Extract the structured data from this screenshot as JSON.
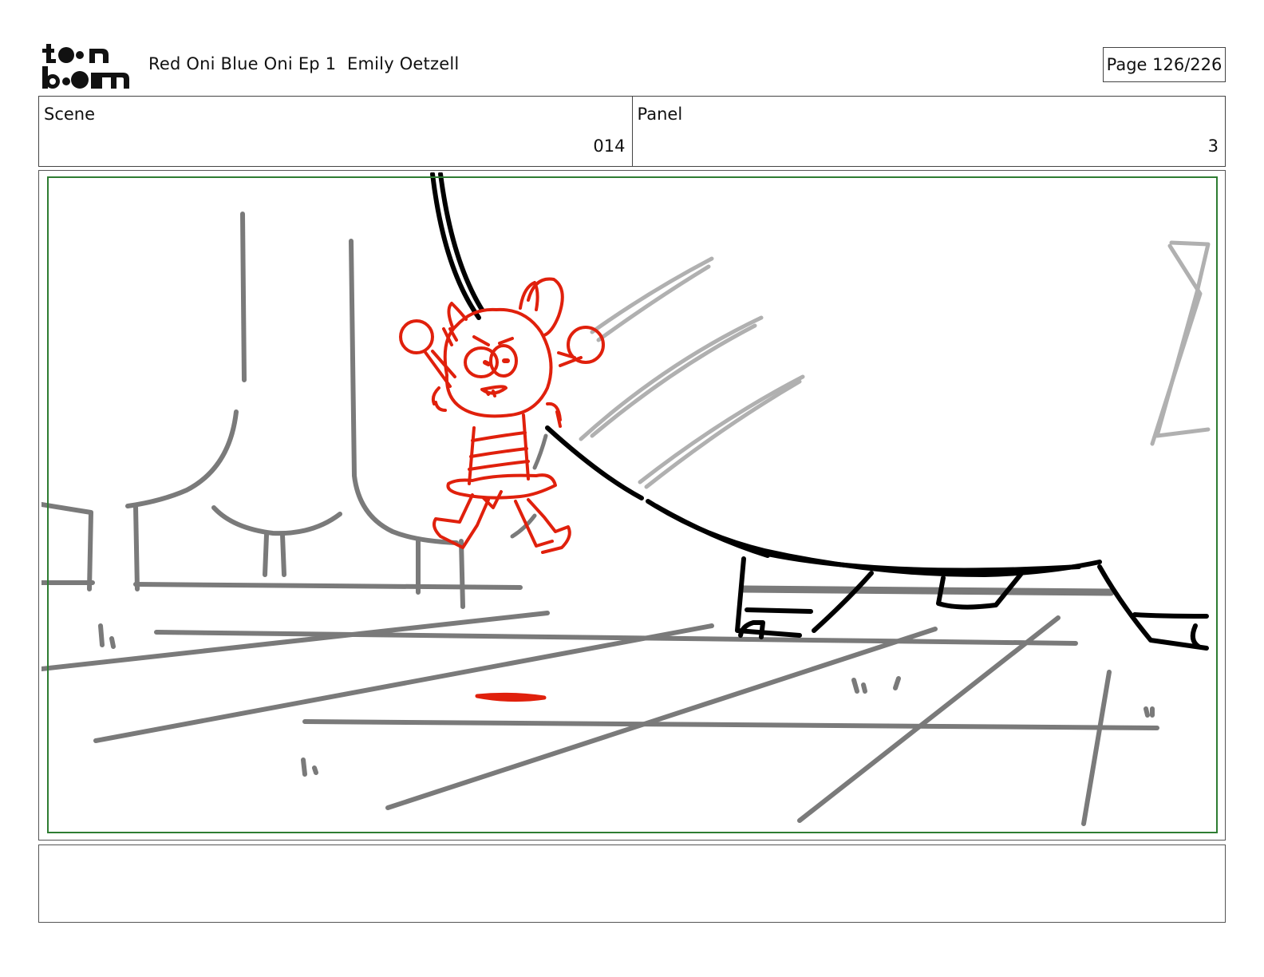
{
  "header": {
    "logo_text": "toonboom",
    "title": "Red Oni Blue Oni Ep 1  Emily Oetzell",
    "page_label": "Page 126/226"
  },
  "info": {
    "scene_label": "Scene",
    "scene_value": "014",
    "panel_label": "Panel",
    "panel_value": "3"
  },
  "panel": {
    "safe_frame_color": "#2e7d32",
    "sketch_colors": {
      "character": "#e0200c",
      "foreground": "#000000",
      "background": "#7a7a7a",
      "light": "#b0b0b0"
    }
  },
  "notes": {
    "text": ""
  }
}
